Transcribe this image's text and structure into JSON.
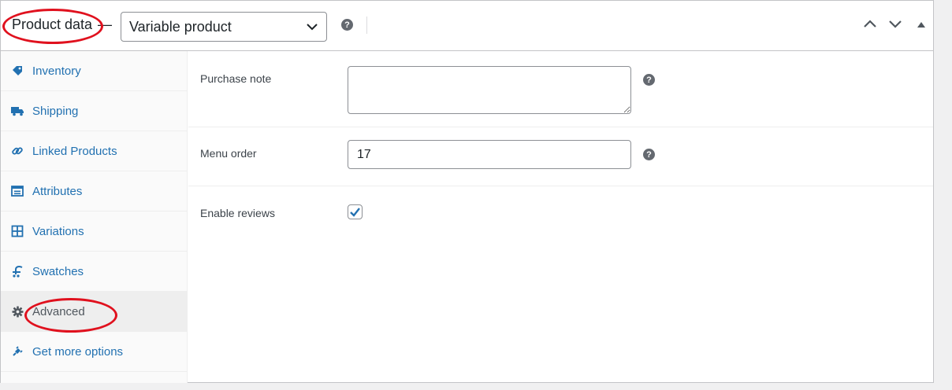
{
  "header": {
    "title": "Product data",
    "separator": "—",
    "product_type": {
      "selected": "Variable product",
      "options": [
        "Variable product"
      ]
    },
    "help": "?"
  },
  "tabs": [
    {
      "label": "Inventory",
      "icon": "tag-icon"
    },
    {
      "label": "Shipping",
      "icon": "truck-icon"
    },
    {
      "label": "Linked Products",
      "icon": "link-icon"
    },
    {
      "label": "Attributes",
      "icon": "attributes-icon"
    },
    {
      "label": "Variations",
      "icon": "grid-icon"
    },
    {
      "label": "Swatches",
      "icon": "swatches-icon"
    },
    {
      "label": "Advanced",
      "icon": "gear-icon",
      "active": true
    },
    {
      "label": "Get more options",
      "icon": "plugin-icon"
    }
  ],
  "advanced": {
    "purchase_note": {
      "label": "Purchase note",
      "value": "",
      "help": "?"
    },
    "menu_order": {
      "label": "Menu order",
      "value": "17",
      "help": "?"
    },
    "enable_reviews": {
      "label": "Enable reviews",
      "checked": true
    }
  },
  "colors": {
    "link": "#2271b1",
    "annotation": "#e0111e",
    "border": "#c3c4c7"
  }
}
